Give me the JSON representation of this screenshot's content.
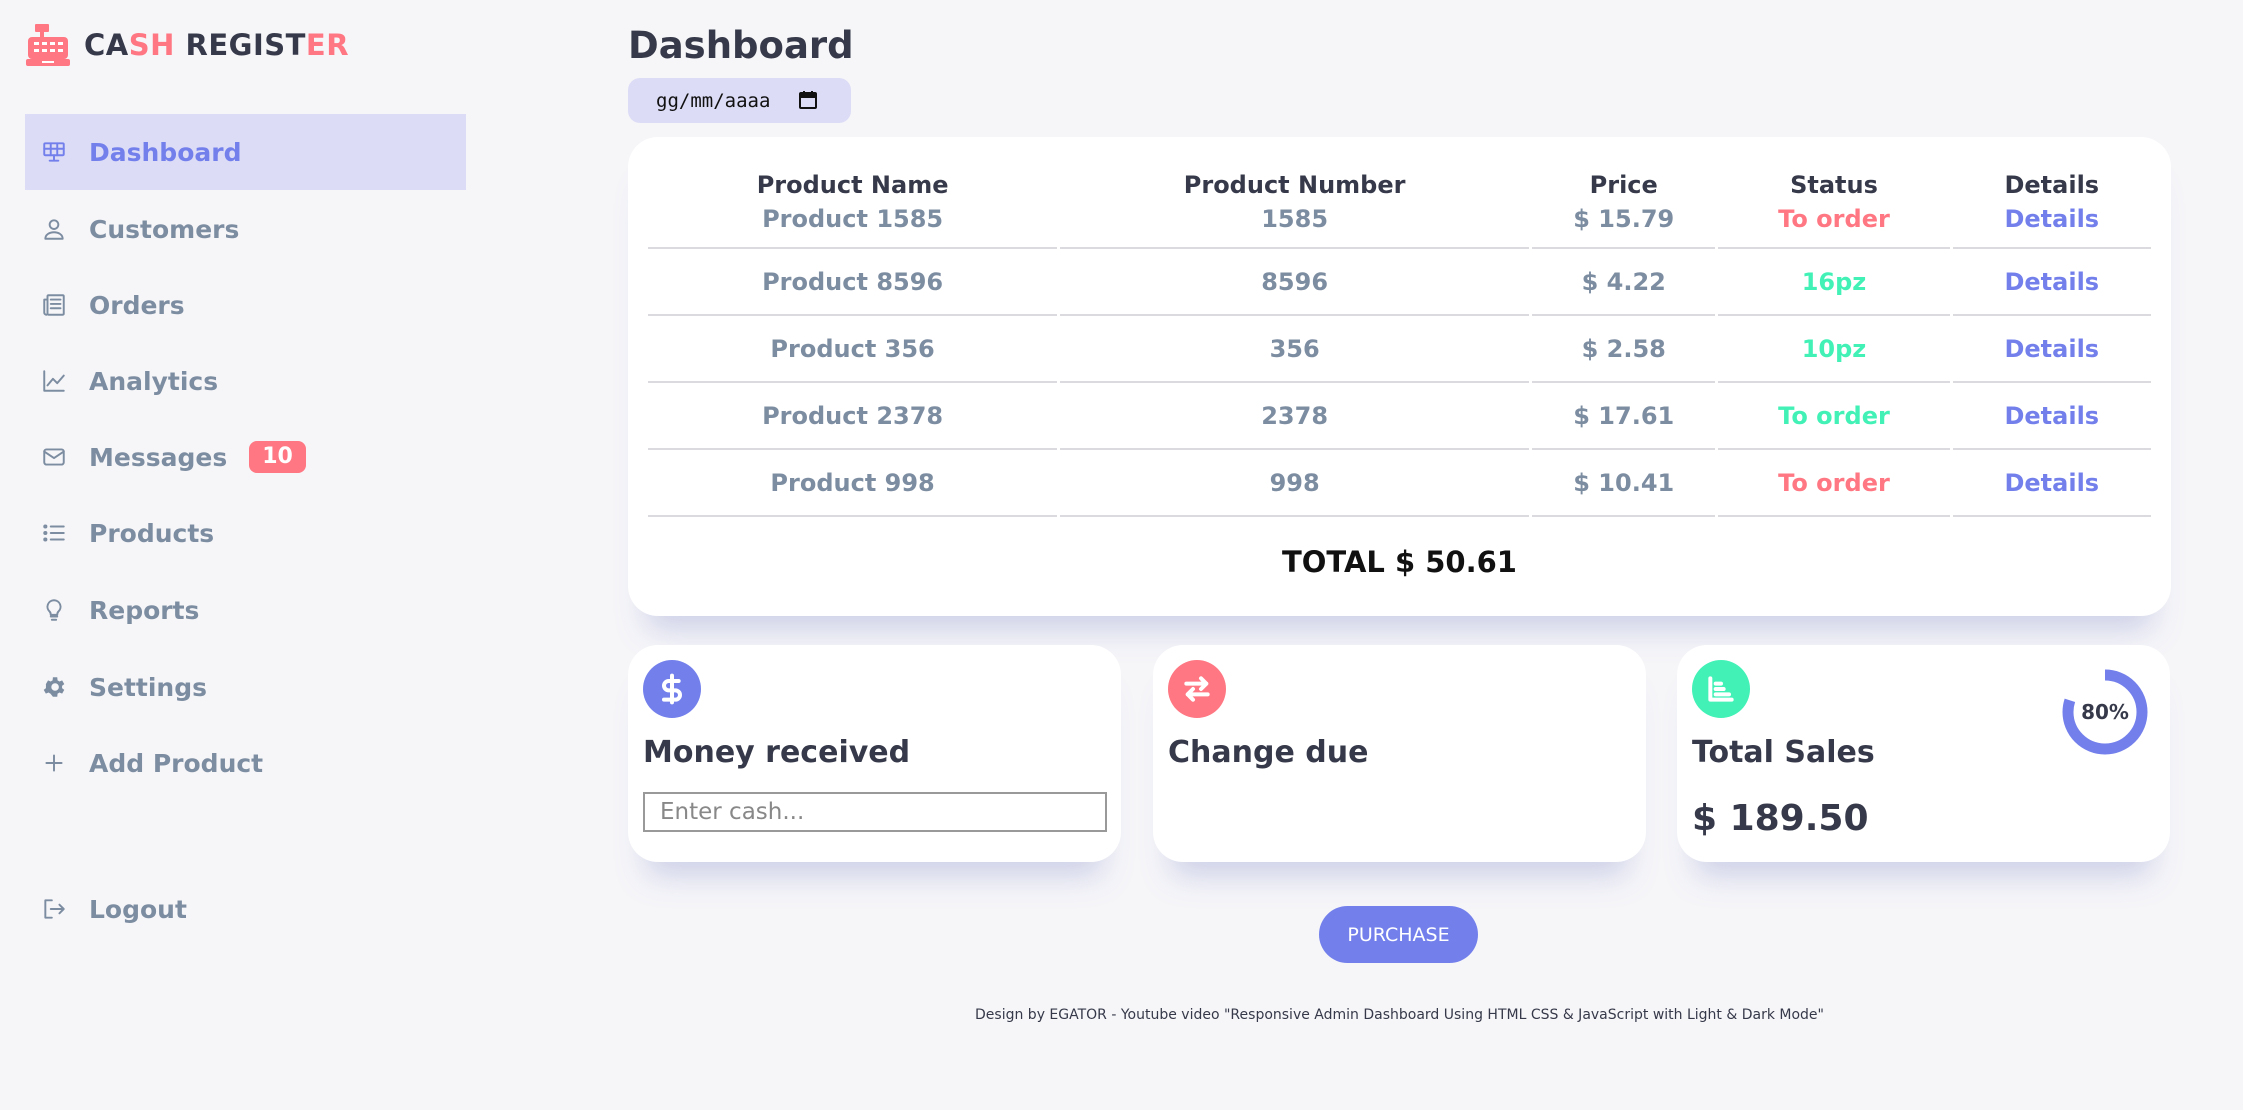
{
  "brand": {
    "part1": "CA",
    "part2": "SH",
    "part3": " REGIST",
    "part4": "ER"
  },
  "sidebar": {
    "items": [
      {
        "label": "Dashboard",
        "icon": "dashboard-icon"
      },
      {
        "label": "Customers",
        "icon": "person-icon"
      },
      {
        "label": "Orders",
        "icon": "receipt-icon"
      },
      {
        "label": "Analytics",
        "icon": "insights-icon"
      },
      {
        "label": "Messages",
        "icon": "mail-icon",
        "badge": "10"
      },
      {
        "label": "Products",
        "icon": "list-icon"
      },
      {
        "label": "Reports",
        "icon": "lightbulb-icon"
      },
      {
        "label": "Settings",
        "icon": "gear-icon"
      },
      {
        "label": "Add Product",
        "icon": "plus-icon"
      }
    ],
    "logout": "Logout"
  },
  "main": {
    "title": "Dashboard",
    "date_placeholder": "gg/mm/aaaa",
    "table": {
      "headers": [
        "Product Name",
        "Product Number",
        "Price",
        "Status",
        "Details"
      ],
      "rows": [
        {
          "name": "Product 1585",
          "number": "1585",
          "price": "$ 15.79",
          "status": "To order",
          "status_color": "#ff7782",
          "details": "Details"
        },
        {
          "name": "Product 8596",
          "number": "8596",
          "price": "$ 4.22",
          "status": "16pz",
          "status_color": "#41f1b6",
          "details": "Details"
        },
        {
          "name": "Product 356",
          "number": "356",
          "price": "$ 2.58",
          "status": "10pz",
          "status_color": "#41f1b6",
          "details": "Details"
        },
        {
          "name": "Product 2378",
          "number": "2378",
          "price": "$ 17.61",
          "status": "To order",
          "status_color": "#41f1b6",
          "details": "Details"
        },
        {
          "name": "Product 998",
          "number": "998",
          "price": "$ 10.41",
          "status": "To order",
          "status_color": "#ff7782",
          "details": "Details"
        }
      ],
      "total": "TOTAL $ 50.61"
    },
    "money_received": {
      "title": "Money received",
      "placeholder": "Enter cash...",
      "icon": "dollar-icon",
      "icon_color": "#7380ec"
    },
    "change_due": {
      "title": "Change due",
      "icon": "swap-icon",
      "icon_color": "#ff7782"
    },
    "total_sales": {
      "title": "Total Sales",
      "amount": "$ 189.50",
      "progress_label": "80%",
      "progress": 0.8,
      "icon": "bar-chart-icon",
      "icon_color": "#41f1b6"
    },
    "purchase_label": "PURCHASE",
    "footer": "Design by EGATOR - Youtube video \"Responsive Admin Dashboard Using HTML CSS & JavaScript with Light & Dark Mode\""
  },
  "colors": {
    "primary": "#7380ec",
    "danger": "#ff7782",
    "success": "#41f1b6",
    "background": "#f6f6f9"
  }
}
